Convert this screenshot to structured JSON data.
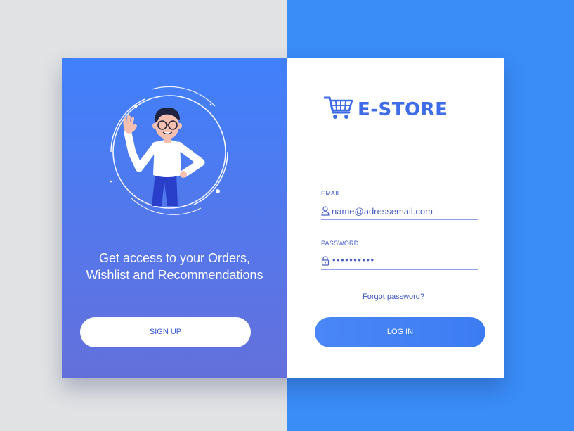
{
  "left_panel": {
    "tagline_line1": "Get access to your Orders,",
    "tagline_line2": "Wishlist and Recommendations",
    "signup_label": "SIGN UP"
  },
  "right_panel": {
    "brand": "E-STORE",
    "email": {
      "label": "EMAIL",
      "placeholder": "name@adressemail.com",
      "icon": "user-icon"
    },
    "password": {
      "label": "PASSWORD",
      "masked_value": "••••••••••",
      "icon": "lock-icon"
    },
    "forgot_label": "Forgot password?",
    "login_label": "LOG IN"
  },
  "colors": {
    "primary": "#3a8cf7",
    "brand": "#3f6de8",
    "left_gradient_top": "#4080fb",
    "left_gradient_bottom": "#6370da",
    "background_gray": "#e1e2e4"
  }
}
